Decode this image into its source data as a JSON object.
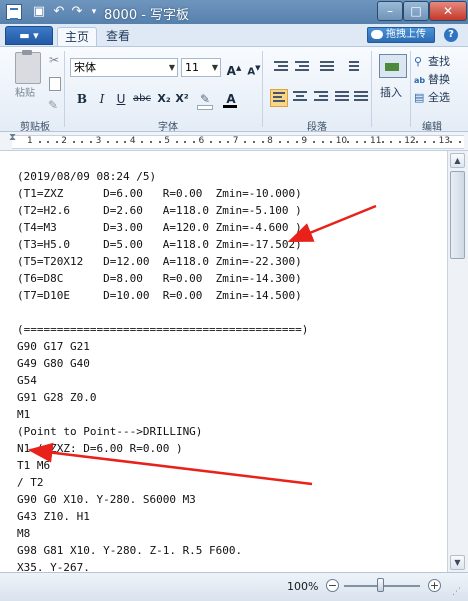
{
  "window": {
    "title": "8000 - 写字板",
    "minimize": "–",
    "maximize": "□",
    "close": "✕"
  },
  "quick_access": {
    "save_icon": "save-icon",
    "undo_icon": "undo-icon",
    "redo_icon": "redo-icon"
  },
  "tabs": {
    "file": "▬ ▾",
    "home": "主页",
    "view": "查看"
  },
  "upload_button": "拖拽上传",
  "ribbon": {
    "clipboard": {
      "paste": "粘贴",
      "label": "剪贴板"
    },
    "font": {
      "font_name": "宋体",
      "font_size": "11",
      "grow": "A",
      "shrink": "A",
      "bold": "B",
      "italic": "I",
      "underline": "U",
      "strike": "abc",
      "subscript": "X₂",
      "superscript": "X²",
      "label": "字体"
    },
    "paragraph": {
      "label": "段落"
    },
    "insert": {
      "label": "插入"
    },
    "edit": {
      "find": "查找",
      "replace": "替换",
      "select_all": "全选",
      "label": "编辑"
    }
  },
  "ruler": {
    "numbers": [
      "1",
      "2",
      "3",
      "4",
      "5",
      "6",
      "7",
      "8",
      "9",
      "10",
      "11",
      "12",
      "13"
    ]
  },
  "document": {
    "lines": [
      "(2019/08/09 08:24 /5)",
      "(T1=ZXZ      D=6.00   R=0.00  Zmin=-10.000)",
      "(T2=H2.6     D=2.60   A=118.0 Zmin=-5.100 )",
      "(T4=M3       D=3.00   A=120.0 Zmin=-4.600 )",
      "(T3=H5.0     D=5.00   A=118.0 Zmin=-17.502)",
      "(T5=T20X12   D=12.00  A=118.0 Zmin=-22.300)",
      "(T6=D8C      D=8.00   R=0.00  Zmin=-14.300)",
      "(T7=D10E     D=10.00  R=0.00  Zmin=-14.500)",
      "",
      "(==========================================)",
      "G90 G17 G21",
      "G49 G80 G40",
      "G54",
      "G91 G28 Z0.0",
      "M1",
      "(Point to Point--->DRILLING)",
      "N1 ( ZXZ: D=6.00 R=0.00 )",
      "T1 M6",
      "/ T2",
      "G90 G0 X10. Y-280. S6000 M3",
      "G43 Z10. H1",
      "M8",
      "G98 G81 X10. Y-280. Z-1. R.5 F600.",
      "X35. Y-267."
    ]
  },
  "statusbar": {
    "zoom": "100%",
    "zoom_out": "−",
    "zoom_in": "+"
  },
  "colors": {
    "annotation_arrow": "#e8211b",
    "titlebar": "#6f95bd"
  }
}
